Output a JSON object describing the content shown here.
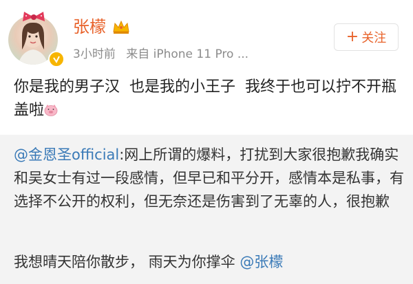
{
  "post": {
    "username": "张檬",
    "time": "3小时前",
    "source": "来自 iPhone 11 Pro ...",
    "follow_label": "关注",
    "text": "你是我的男子汉  也是我的小王子  我终于也可以拧不开瓶盖啦"
  },
  "repost": {
    "mention": "@金恩圣official",
    "text": ":网上所谓的爆料，打扰到大家很抱歉我确实和吴女士有过一段感情，但早已和平分开，感情本是私事，有选择不公开的权利，但无奈还是伤害到了无辜的人，很抱歉",
    "footer_text": "我想晴天陪你散步，  雨天为你撑伞 ",
    "footer_mention": "@张檬"
  },
  "colors": {
    "username": "#e8622a",
    "mention": "#3a7ab7",
    "badge": "#f7b500",
    "repost_bg": "#f3f3f3"
  },
  "icons": {
    "crown": "crown-icon",
    "verified": "verified-badge-icon",
    "pig": "pig-emoji-icon",
    "plus": "plus-icon"
  }
}
